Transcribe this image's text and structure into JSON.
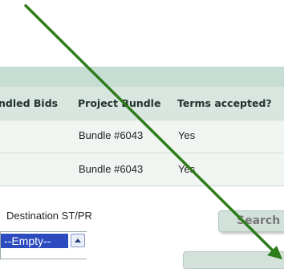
{
  "table": {
    "columns": [
      "ndled Bids",
      "Project Bundle",
      "Terms accepted?"
    ],
    "rows": [
      {
        "project_bundle": "Bundle #6043",
        "terms_accepted": "Yes"
      },
      {
        "project_bundle": "Bundle #6043",
        "terms_accepted": "Yes"
      }
    ]
  },
  "filters": {
    "destination_label": "Destination ST/PR",
    "destination_selected": "--Empty--"
  },
  "buttons": {
    "search_label": "Search"
  },
  "icons": {
    "annotation_arrow": "arrow-icon",
    "scroll_up": "scroll-up-arrow-icon"
  },
  "colors": {
    "annotation_arrow": "#2e7d1a",
    "header_strip": "#c5ddd2",
    "list_selection": "#2b4bbf"
  }
}
